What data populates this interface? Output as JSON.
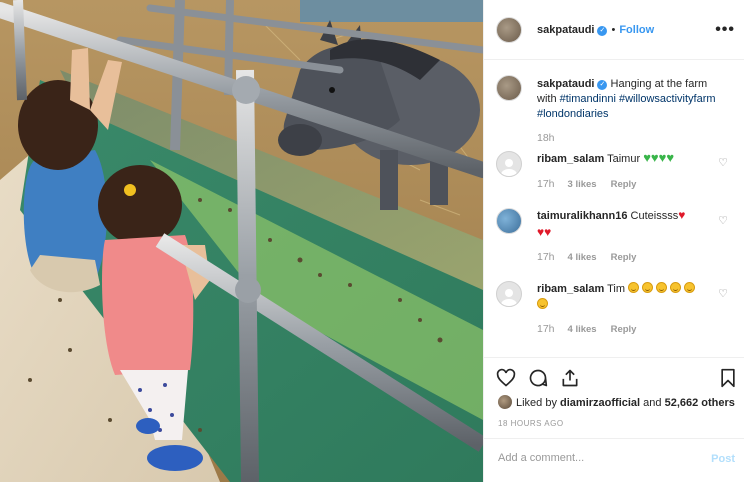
{
  "post": {
    "author": "sakpataudi",
    "follow_label": "Follow",
    "dot": "•",
    "more_label": "•••",
    "caption_text": "Hanging at the farm with ",
    "hashtags": [
      "#timandinni",
      "#willowsactivityfarm",
      "#londondiaries"
    ],
    "caption_time": "18h"
  },
  "comments": [
    {
      "user": "ribam_salam",
      "text": "Taimur ",
      "emoji": [
        "green-heart",
        "green-heart",
        "green-heart",
        "green-heart"
      ],
      "emoji_char": "♥",
      "time": "17h",
      "likes": "3 likes",
      "reply": "Reply"
    },
    {
      "user": "taimuralikhann16",
      "text": "Cuteissss",
      "emoji": [
        "red-heart",
        "red-heart",
        "red-heart"
      ],
      "emoji_char": "♥",
      "time": "17h",
      "likes": "4 likes",
      "reply": "Reply"
    },
    {
      "user": "ribam_salam",
      "text": "Tim",
      "emoji": [
        "grin",
        "grin",
        "grin",
        "grin",
        "grin",
        "grin"
      ],
      "time": "17h",
      "likes": "4 likes",
      "reply": "Reply"
    }
  ],
  "likes": {
    "prefix": "Liked by ",
    "user": "diamirzaofficial",
    "mid": " and ",
    "count": "52,662 others"
  },
  "timestamp": "18 HOURS AGO",
  "add_comment": {
    "placeholder": "Add a comment...",
    "post_label": "Post"
  },
  "icons": [
    "like-heart-icon",
    "comment-icon",
    "share-icon",
    "bookmark-icon",
    "comment-like-heart-icon"
  ],
  "colors": {
    "accent": "#3897f0",
    "hashtag": "#003569",
    "green_heart": "#39b54a",
    "red_heart": "#e0192a",
    "post_disabled": "#b2dffc"
  }
}
